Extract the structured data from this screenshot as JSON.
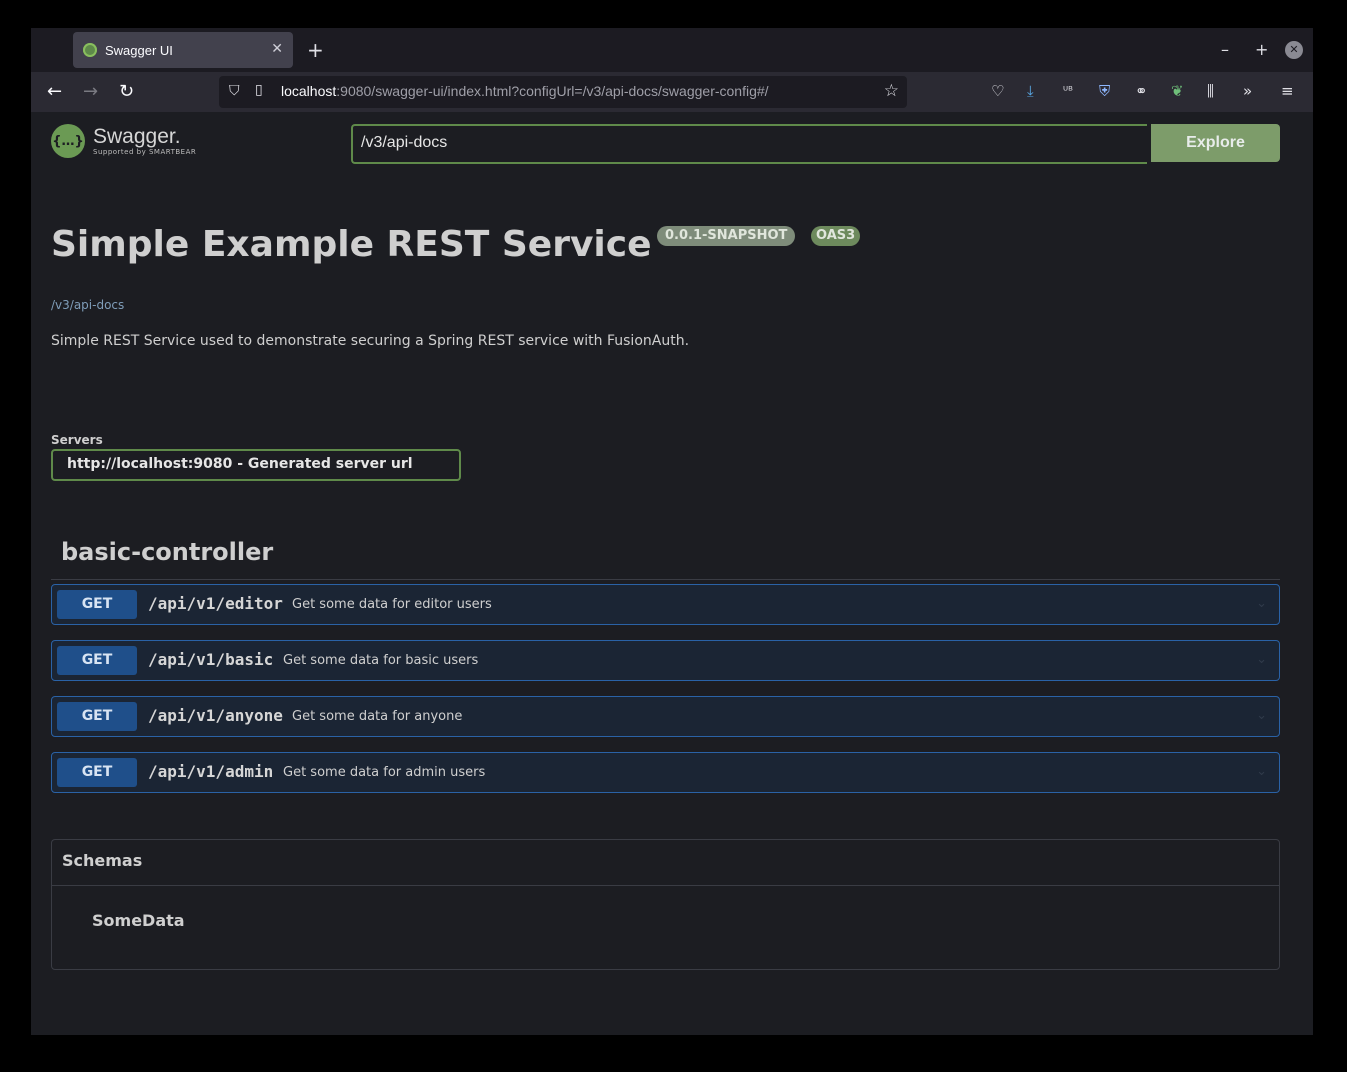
{
  "browser": {
    "tab_title": "Swagger UI",
    "new_tab": "+",
    "window_min": "–",
    "window_max": "+",
    "window_close": "✕",
    "url_host": "localhost",
    "url_rest": ":9080/swagger-ui/index.html?configUrl=/v3/api-docs/swagger-config#/"
  },
  "swagger": {
    "logo_mark": "{…}",
    "logo_name": "Swagger.",
    "logo_sub": "Supported by SMARTBEAR",
    "spec_url": "/v3/api-docs",
    "explore_label": "Explore"
  },
  "info": {
    "title": "Simple Example REST Service",
    "version": "0.0.1-SNAPSHOT",
    "oas": "OAS3",
    "url": "/v3/api-docs",
    "description": "Simple REST Service used to demonstrate securing a Spring REST service with FusionAuth."
  },
  "servers": {
    "label": "Servers",
    "selected": "http://localhost:9080 - Generated server url"
  },
  "tag": {
    "name": "basic-controller",
    "operations": [
      {
        "method": "GET",
        "path": "/api/v1/editor",
        "summary": "Get some data for editor users"
      },
      {
        "method": "GET",
        "path": "/api/v1/basic",
        "summary": "Get some data for basic users"
      },
      {
        "method": "GET",
        "path": "/api/v1/anyone",
        "summary": "Get some data for anyone"
      },
      {
        "method": "GET",
        "path": "/api/v1/admin",
        "summary": "Get some data for admin users"
      }
    ]
  },
  "schemas": {
    "title": "Schemas",
    "items": [
      "SomeData"
    ]
  },
  "colors": {
    "accent_green": "#7d9c6a",
    "get_blue": "#1f4f8a",
    "background": "#1c1d22"
  }
}
